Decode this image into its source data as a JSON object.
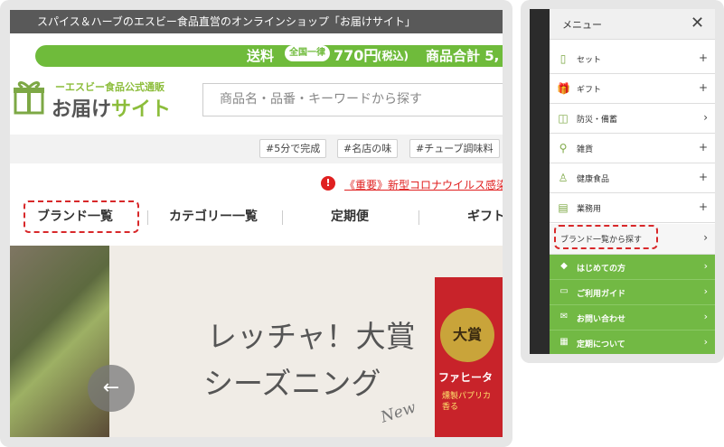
{
  "left_page": {
    "topbar_text": "スパイス＆ハーブのエスビー食品直営のオンラインショップ「お届けサイト」",
    "shipping": {
      "label": "送料",
      "badge": "全国一律",
      "price": "770円",
      "tax": "(税込)",
      "total": "商品合計 5,"
    },
    "logo": {
      "sub": "ーエスビー食品公式通販",
      "main_a": "お届け",
      "main_b": "サイト"
    },
    "search_placeholder": "商品名・品番・キーワードから探す",
    "tags": [
      "#5分で完成",
      "#名店の味",
      "#チューブ調味料"
    ],
    "notice": {
      "icon": "!",
      "text": "《重要》新型コロナウイルス感染"
    },
    "nav": [
      "ブランド一覧",
      "カテゴリー一覧",
      "定期便",
      "ギフト"
    ],
    "hero": {
      "arrow": "←",
      "title1": "レッチャ！大賞",
      "title2": "シーズニング",
      "new": "New",
      "product_badge": "大賞",
      "product_name": "ファヒータ",
      "product_sub": "燻製パプリカ香る"
    }
  },
  "menu": {
    "title": "メニュー",
    "close": "✕",
    "items": [
      {
        "icon": "set-icon",
        "glyph": "▯",
        "label": "セット",
        "action": "+"
      },
      {
        "icon": "gift-icon",
        "glyph": "🎁",
        "label": "ギフト",
        "action": "+"
      },
      {
        "icon": "emergency-icon",
        "glyph": "◫",
        "label": "防災・備蓄",
        "action": "›"
      },
      {
        "icon": "goods-icon",
        "glyph": "⚲",
        "label": "雑貨",
        "action": "+"
      },
      {
        "icon": "health-icon",
        "glyph": "♙",
        "label": "健康食品",
        "action": "+"
      },
      {
        "icon": "business-icon",
        "glyph": "▤",
        "label": "業務用",
        "action": "+"
      },
      {
        "icon": "",
        "glyph": "",
        "label": "ブランド一覧から探す",
        "action": "›"
      }
    ],
    "green_items": [
      {
        "icon": "shield-icon",
        "glyph": "◆",
        "label": "はじめての方"
      },
      {
        "icon": "guide-icon",
        "glyph": "▭",
        "label": "ご利用ガイド"
      },
      {
        "icon": "mail-icon",
        "glyph": "✉",
        "label": "お問い合わせ"
      },
      {
        "icon": "calendar-icon",
        "glyph": "▦",
        "label": "定期について"
      }
    ],
    "green_arrow": "›"
  },
  "colors": {
    "accent": "#72b944",
    "highlight": "#d8282a",
    "notice": "#e02020"
  }
}
